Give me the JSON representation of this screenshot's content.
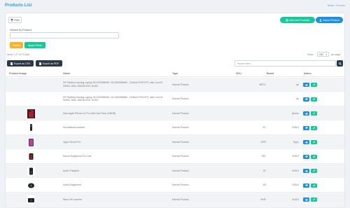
{
  "header": {
    "title": "Products List",
    "breadcrumb_home": "Home",
    "breadcrumb_sep": "/",
    "breadcrumb_current": "Products"
  },
  "toolbar": {
    "filter_label": "Filter",
    "add_label": "Add new Products",
    "import_label": "Import Product"
  },
  "filters": {
    "search_label": "Search by Product",
    "search_value": "",
    "cancel_label": "Cancel",
    "apply_label": "Apply Filters"
  },
  "listing": {
    "items_text": "Items 1-37 of 37 total",
    "show_label": "Show",
    "per_page_value": "100",
    "per_page_label": "per page"
  },
  "actions": {
    "export_csv": "Export as CSV",
    "export_pdf": "Export as PDF",
    "search_placeholder": "Search here..."
  },
  "table": {
    "columns": [
      "Product Image",
      "Name",
      "Type",
      "SKU",
      "Brand",
      "Action"
    ],
    "rows": [
      {
        "image": "",
        "name": "HP Pavilion Gaming Laptop 15-DK0056WM / 15-DK0056WM - 15.6inch FHD IPS, Intel Core i5-9300H, 8GB, 256GB SSD, NVIDI",
        "type": "Normal Product",
        "sku": "MPCL",
        "brand": "hp"
      },
      {
        "image": "",
        "name": "HP Pavilion Gaming Laptop 15-DK0056WM / 15-DK0056WM - 15.6inch FHD IPS, Intel Core i5-9300H, 8GB, 256GB SSD, NVIDI",
        "type": "Normal Product",
        "sku": "",
        "brand": "hp"
      },
      {
        "image": "phone",
        "name": "New Apple iPhone 12 Pro with FaceTime (128GB)",
        "type": "Normal Product",
        "sku": "",
        "brand": "iphone"
      },
      {
        "image": "camera",
        "name": "Surveillance camera",
        "type": "Normal Product",
        "sku": "SC",
        "brand": "SUDO"
      },
      {
        "image": "oppo",
        "name": "Oppo Reno3 Pro",
        "type": "Normal Product",
        "sku": "ORP",
        "brand": "Oppo"
      },
      {
        "image": "speaker",
        "name": "Sound Equipment For Low",
        "type": "Normal Product",
        "sku": "SEL",
        "brand": "SUDO"
      },
      {
        "image": "audio",
        "name": "Audio Theaters",
        "type": "Normal Product",
        "sku": "AT",
        "brand": "SUDO"
      },
      {
        "image": "audioeq",
        "name": "Audio Equipment",
        "type": "Normal Product",
        "sku": "AE",
        "brand": "SUDO"
      },
      {
        "image": "nikon",
        "name": "Nikon HD camera",
        "type": "Normal Product",
        "sku": "NHD",
        "brand": "SUDO"
      }
    ]
  },
  "colors": {
    "accent_blue": "#1f8fe0",
    "accent_green": "#19c79a",
    "accent_orange": "#f6b42c",
    "dark": "#2c3a48",
    "title_blue": "#2f9ee3"
  },
  "icons": {
    "filter": "filter-icon",
    "add": "plus-circle-icon",
    "import": "user-icon",
    "csv": "file-icon",
    "pdf": "file-icon",
    "search": "search-icon",
    "view": "eye-icon",
    "edit": "edit-icon"
  }
}
